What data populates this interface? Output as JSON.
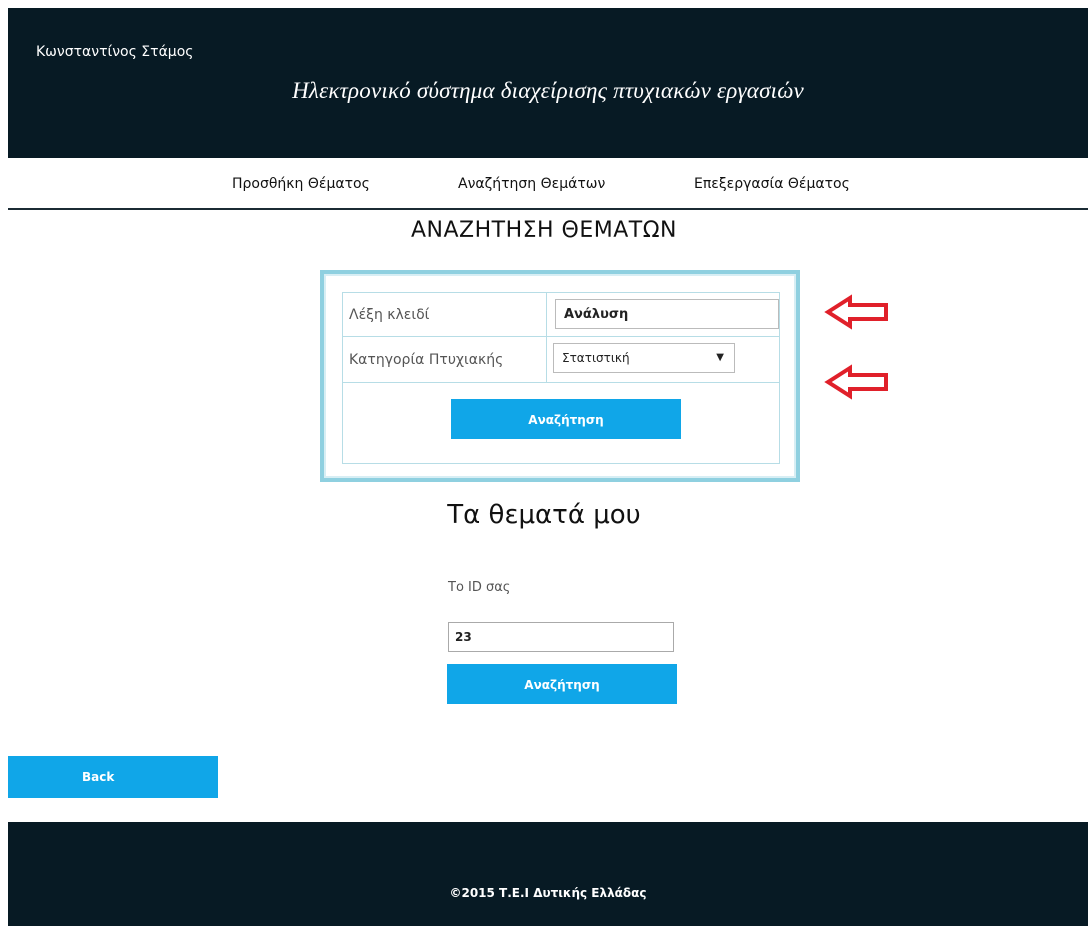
{
  "header": {
    "user_name": "Κωνσταντίνος Στάμος",
    "title": "Ηλεκτρονικό σύστημα διαχείρισης πτυχιακών εργασιών"
  },
  "nav": {
    "items": [
      {
        "label": "Προσθήκη Θέματος"
      },
      {
        "label": "Αναζήτηση Θεμάτων"
      },
      {
        "label": "Επεξεργασία Θέματος"
      }
    ]
  },
  "main": {
    "heading": "ΑΝΑΖΗΤΗΣΗ ΘΕΜΑΤΩΝ",
    "search_form": {
      "keyword_label": "Λέξη κλειδί",
      "keyword_value": "Ανάλυση",
      "category_label": "Κατηγορία Πτυχιακής",
      "category_value": "Στατιστική",
      "search_button": "Αναζήτηση"
    },
    "my_topics": {
      "heading": "Τα θεματά μου",
      "id_label": "Το ID σας",
      "id_value": "23",
      "search_button": "Αναζήτηση"
    },
    "back_button": "Back"
  },
  "footer": {
    "copyright": "©2015 Τ.Ε.Ι Δυτικής Ελλάδας"
  },
  "colors": {
    "header_bg": "#071a24",
    "button_bg": "#10a6e8",
    "frame_border": "#8fd0e0",
    "annotation_arrow": "#e0202a"
  },
  "icons": {
    "annotation": "red-arrow-left-icon",
    "dropdown": "chevron-down-icon"
  }
}
